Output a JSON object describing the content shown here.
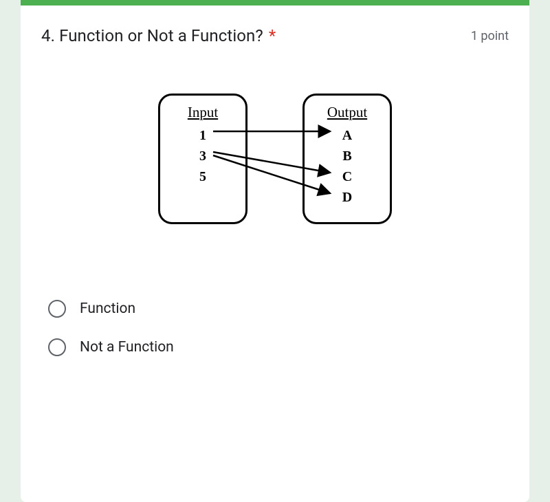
{
  "question": {
    "number": "4.",
    "title": "Function or Not a Function?",
    "required_marker": "*",
    "points": "1 point"
  },
  "diagram": {
    "input_header": "Input",
    "output_header": "Output",
    "inputs": [
      "1",
      "3",
      "5"
    ],
    "outputs": [
      "A",
      "B",
      "C",
      "D"
    ],
    "mappings": [
      {
        "from": "1",
        "to": "A"
      },
      {
        "from": "3",
        "to": "C"
      },
      {
        "from": "3",
        "to": "D"
      }
    ]
  },
  "options": [
    {
      "label": "Function",
      "selected": false
    },
    {
      "label": "Not a Function",
      "selected": false
    }
  ]
}
